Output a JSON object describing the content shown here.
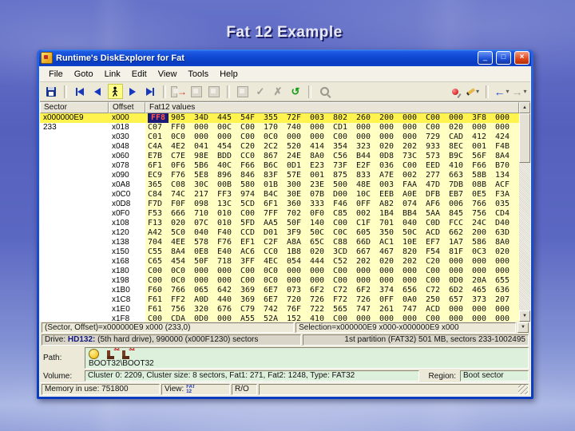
{
  "slide": {
    "title": "Fat 12 Example"
  },
  "window": {
    "title": "Runtime's DiskExplorer for Fat",
    "menu": [
      "File",
      "Goto",
      "Link",
      "Edit",
      "View",
      "Tools",
      "Help"
    ]
  },
  "icons": {
    "minimize": "_",
    "maximize": "□",
    "close": "×",
    "check": "✓",
    "cross": "✗",
    "refresh": "↺",
    "back": "←",
    "forward": "→",
    "link_arrow": "→",
    "dropdown": "▾",
    "up": "▲",
    "down": "▼"
  },
  "table": {
    "columns": [
      "Sector",
      "Offset",
      "Fat12 values"
    ],
    "rows": [
      {
        "sector": "x000000E9",
        "offset": "x000",
        "values": [
          "FF8",
          "905",
          "34D",
          "445",
          "54F",
          "355",
          "72F",
          "003",
          "802",
          "260",
          "200",
          "000",
          "C00",
          "000",
          "3F8",
          "000"
        ]
      },
      {
        "sector": "233",
        "offset": "x018",
        "values": [
          "C07",
          "FF0",
          "000",
          "00C",
          "C00",
          "170",
          "740",
          "000",
          "CD1",
          "000",
          "000",
          "000",
          "C00",
          "020",
          "000",
          "000"
        ]
      },
      {
        "sector": "",
        "offset": "x030",
        "values": [
          "C01",
          "0C0",
          "000",
          "000",
          "C00",
          "0C0",
          "000",
          "000",
          "C00",
          "000",
          "000",
          "000",
          "729",
          "CAD",
          "412",
          "424"
        ]
      },
      {
        "sector": "",
        "offset": "x048",
        "values": [
          "C4A",
          "4E2",
          "041",
          "454",
          "C20",
          "2C2",
          "520",
          "414",
          "354",
          "323",
          "020",
          "202",
          "933",
          "8EC",
          "001",
          "F4B"
        ]
      },
      {
        "sector": "",
        "offset": "x060",
        "values": [
          "E7B",
          "C7E",
          "98E",
          "BDD",
          "CC0",
          "867",
          "24E",
          "8A0",
          "C56",
          "B44",
          "0D8",
          "73C",
          "573",
          "B9C",
          "56F",
          "8A4"
        ]
      },
      {
        "sector": "",
        "offset": "x078",
        "values": [
          "6F1",
          "0F6",
          "5B6",
          "40C",
          "F66",
          "B6C",
          "0D1",
          "E23",
          "73F",
          "E2F",
          "036",
          "C00",
          "EED",
          "410",
          "F66",
          "B70"
        ]
      },
      {
        "sector": "",
        "offset": "x090",
        "values": [
          "EC9",
          "F76",
          "5E8",
          "896",
          "846",
          "83F",
          "57E",
          "001",
          "875",
          "833",
          "A7E",
          "002",
          "277",
          "663",
          "58B",
          "134"
        ]
      },
      {
        "sector": "",
        "offset": "x0A8",
        "values": [
          "365",
          "C08",
          "30C",
          "00B",
          "580",
          "01B",
          "300",
          "23E",
          "500",
          "48E",
          "003",
          "FAA",
          "47D",
          "7DB",
          "08B",
          "ACF"
        ]
      },
      {
        "sector": "",
        "offset": "x0C0",
        "values": [
          "C84",
          "74C",
          "217",
          "FF3",
          "974",
          "B4C",
          "30E",
          "07B",
          "D00",
          "10C",
          "EEB",
          "A0E",
          "DFB",
          "EB7",
          "0E5",
          "F3A"
        ]
      },
      {
        "sector": "",
        "offset": "x0D8",
        "values": [
          "F7D",
          "F0F",
          "098",
          "13C",
          "5CD",
          "6F1",
          "360",
          "333",
          "F46",
          "0FF",
          "A82",
          "074",
          "AF6",
          "006",
          "766",
          "035"
        ]
      },
      {
        "sector": "",
        "offset": "x0F0",
        "values": [
          "F53",
          "666",
          "710",
          "010",
          "C00",
          "7FF",
          "702",
          "0F0",
          "C85",
          "002",
          "1B4",
          "BB4",
          "5AA",
          "845",
          "756",
          "CD4"
        ]
      },
      {
        "sector": "",
        "offset": "x108",
        "values": [
          "F13",
          "020",
          "07C",
          "010",
          "5FD",
          "AA5",
          "50F",
          "140",
          "C00",
          "C1F",
          "701",
          "040",
          "C0D",
          "FCC",
          "24C",
          "D40"
        ]
      },
      {
        "sector": "",
        "offset": "x120",
        "values": [
          "A42",
          "5C0",
          "040",
          "F40",
          "CCD",
          "D01",
          "3F9",
          "50C",
          "C0C",
          "605",
          "350",
          "50C",
          "ACD",
          "662",
          "200",
          "63D"
        ]
      },
      {
        "sector": "",
        "offset": "x138",
        "values": [
          "704",
          "4EE",
          "578",
          "F76",
          "EF1",
          "C2F",
          "A8A",
          "65C",
          "C88",
          "66D",
          "AC1",
          "10E",
          "EF7",
          "1A7",
          "586",
          "8A0"
        ]
      },
      {
        "sector": "",
        "offset": "x150",
        "values": [
          "C55",
          "8A4",
          "0E8",
          "E40",
          "AC6",
          "CC0",
          "1B8",
          "020",
          "3CD",
          "667",
          "467",
          "820",
          "F54",
          "81F",
          "0C3",
          "020"
        ]
      },
      {
        "sector": "",
        "offset": "x168",
        "values": [
          "C65",
          "454",
          "50F",
          "718",
          "3FF",
          "4EC",
          "054",
          "444",
          "C52",
          "202",
          "020",
          "202",
          "C20",
          "000",
          "000",
          "000"
        ]
      },
      {
        "sector": "",
        "offset": "x180",
        "values": [
          "C00",
          "0C0",
          "000",
          "000",
          "C00",
          "0C0",
          "000",
          "000",
          "C00",
          "000",
          "000",
          "000",
          "C00",
          "000",
          "000",
          "000"
        ]
      },
      {
        "sector": "",
        "offset": "x198",
        "values": [
          "C00",
          "0C0",
          "000",
          "000",
          "C00",
          "0C0",
          "000",
          "000",
          "C00",
          "000",
          "000",
          "000",
          "C00",
          "0D0",
          "20A",
          "655"
        ]
      },
      {
        "sector": "",
        "offset": "x1B0",
        "values": [
          "F60",
          "766",
          "065",
          "642",
          "369",
          "6E7",
          "073",
          "6F2",
          "C72",
          "6F2",
          "374",
          "656",
          "C72",
          "6D2",
          "465",
          "636"
        ]
      },
      {
        "sector": "",
        "offset": "x1C8",
        "values": [
          "F61",
          "FF2",
          "A0D",
          "440",
          "369",
          "6E7",
          "720",
          "726",
          "F72",
          "726",
          "0FF",
          "0A0",
          "250",
          "657",
          "373",
          "207"
        ]
      },
      {
        "sector": "",
        "offset": "x1E0",
        "values": [
          "F61",
          "756",
          "320",
          "676",
          "C79",
          "742",
          "76F",
          "722",
          "565",
          "747",
          "261",
          "747",
          "ACD",
          "000",
          "000",
          "000"
        ]
      },
      {
        "sector": "",
        "offset": "x1F8",
        "values": [
          "C00",
          "CDA",
          "0D0",
          "000",
          "A55",
          "52A",
          "152",
          "410",
          "C00",
          "000",
          "000",
          "000",
          "C00",
          "000",
          "000",
          "000"
        ]
      }
    ]
  },
  "status_row": {
    "position": "(Sector, Offset)=x000000E9 x000 (233,0)",
    "selection": "Selection=x000000E9 x000-x000000E9 x000"
  },
  "drive_row": {
    "label": "Drive:",
    "drive": "HD132:",
    "drive_info": "(5th hard drive), 990000 (x000F1230) sectors",
    "partition_info": "1st partition (FAT32) 501 MB, sectors 233-1002495"
  },
  "path_panel": {
    "label": "Path:",
    "path": "BOOT32\\BOOT32",
    "badges": [
      "32",
      "32"
    ]
  },
  "volume_panel": {
    "label": "Volume:",
    "info": "Cluster 0: 2209, Cluster size: 8 sectors, Fat1: 271, Fat2: 1248, Type: FAT32",
    "region_label": "Region:",
    "region": "Boot sector"
  },
  "status_bar": {
    "memory": "Memory in use: 751800",
    "view_label": "View:",
    "view_top": "FAT",
    "view_bottom": "12",
    "mode": "R/O"
  }
}
